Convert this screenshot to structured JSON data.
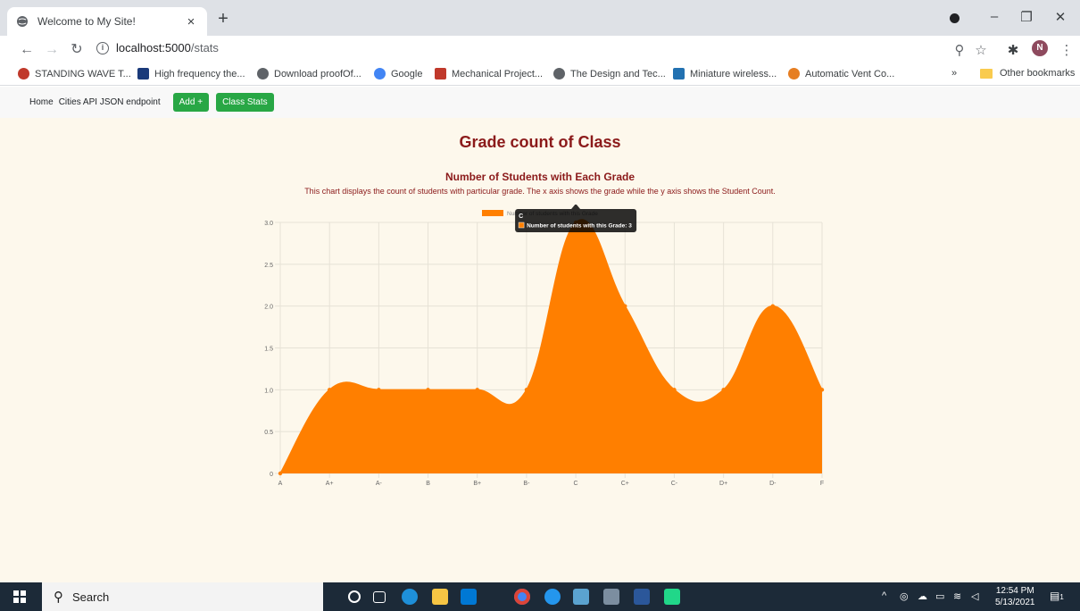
{
  "browser": {
    "tab_title": "Welcome to My Site!",
    "new_tab": "+",
    "close_tab": "×",
    "win_min": "–",
    "win_max": "❐",
    "win_close": "✕",
    "url_host": "localhost:5000",
    "url_path": "/stats",
    "avatar_letter": "N",
    "bookmarks": [
      {
        "label": "STANDING WAVE T...",
        "icon": "red-circle-icon",
        "color": "#c0392b"
      },
      {
        "label": "High frequency the...",
        "icon": "j-icon",
        "color": "#1a3a7a"
      },
      {
        "label": "Download proofOf...",
        "icon": "globe-icon",
        "color": "#5f6368"
      },
      {
        "label": "Google",
        "icon": "google-icon",
        "color": "#4285f4"
      },
      {
        "label": "Mechanical Project...",
        "icon": "wolf-icon",
        "color": "#c0392b"
      },
      {
        "label": "The Design and Tec...",
        "icon": "globe-icon",
        "color": "#5f6368"
      },
      {
        "label": "Miniature wireless...",
        "icon": "wordpress-icon",
        "color": "#2271b1"
      },
      {
        "label": "Automatic Vent Co...",
        "icon": "spiral-icon",
        "color": "#e67e22"
      }
    ],
    "overflow": "»",
    "other_bookmarks": "Other bookmarks"
  },
  "site_nav": {
    "home": "Home",
    "cities": "Cities API JSON endpoint",
    "add": "Add +",
    "stats": "Class Stats"
  },
  "page": {
    "heading": "Grade count of Class",
    "subheading": "Number of Students with Each Grade",
    "description": "This chart displays the count of students with particular grade. The x axis shows the grade while the y axis shows the Student Count."
  },
  "chart_data": {
    "type": "area",
    "categories": [
      "A",
      "A+",
      "A-",
      "B",
      "B+",
      "B-",
      "C",
      "C+",
      "C-",
      "D+",
      "D-",
      "F"
    ],
    "series": [
      {
        "name": "Number of students with this Grade",
        "values": [
          0,
          1,
          1,
          1,
          1,
          1,
          3,
          2,
          1,
          1,
          2,
          1
        ],
        "color": "#ff7f00"
      }
    ],
    "ylim": [
      0,
      3
    ],
    "yticks": [
      "0",
      "0.5",
      "1.0",
      "1.5",
      "2.0",
      "2.5",
      "3.0"
    ],
    "grid": true,
    "legend": "top",
    "tooltip": {
      "title": "C",
      "label": "Number of students with this Grade: 3"
    }
  },
  "taskbar": {
    "search_label": "Search",
    "time": "12:54 PM",
    "date": "5/13/2021",
    "notif_count": "1"
  }
}
